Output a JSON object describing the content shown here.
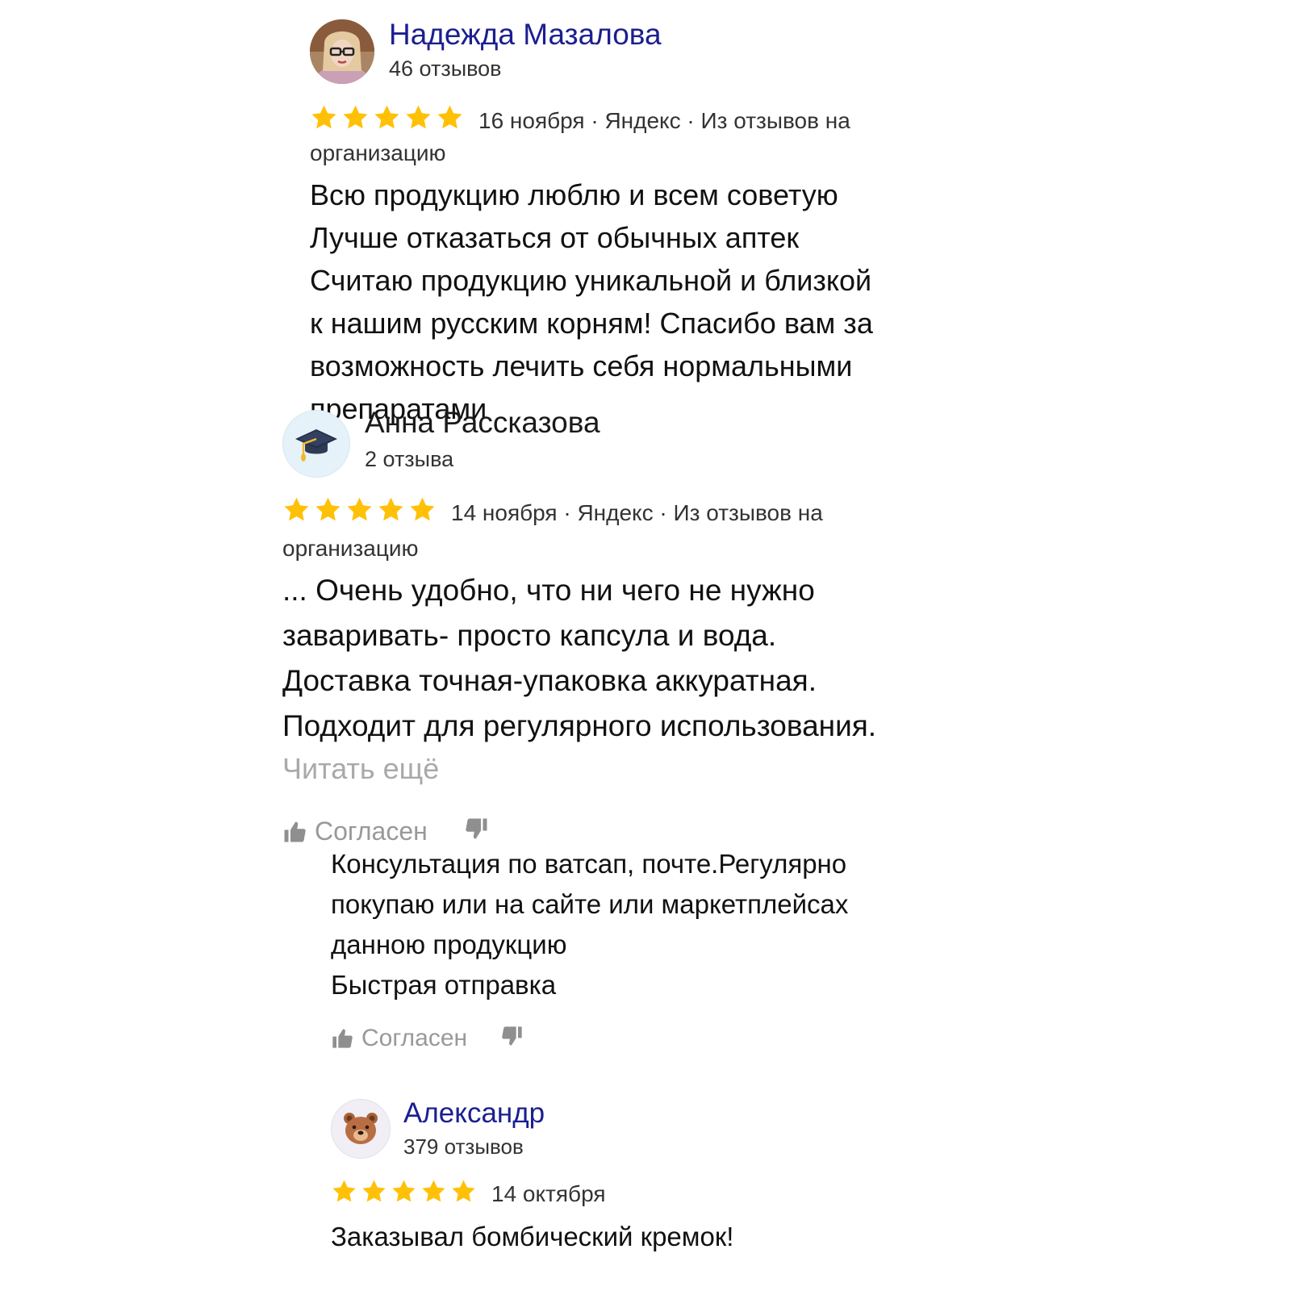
{
  "colors": {
    "author": "#1b1f8f",
    "star": "#ffc107",
    "muted": "#999999"
  },
  "reviews": [
    {
      "author": "Надежда Мазалова",
      "count": "46 отзывов",
      "rating": 5,
      "meta_line1": "16 ноября · Яндекс · Из отзывов на",
      "meta_line2": "организацию",
      "lines": [
        "Всю продукцию люблю и всем советую",
        "Лучше отказаться от обычных аптек",
        "Считаю продукцию уникальной и близкой",
        "к нашим русским корням! Спасибо вам за",
        "возможность лечить себя нормальными",
        "препаратами"
      ]
    },
    {
      "author": "Анна Рассказова",
      "count": "2 отзыва",
      "avatar_icon": "graduation-cap-icon",
      "rating": 5,
      "meta_line1": "14 ноября · Яндекс · Из отзывов на",
      "meta_line2": "организацию",
      "lines": [
        "... Очень удобно, что ни чего не нужно",
        "заваривать- просто капсула и вода.",
        "Доставка точная-упаковка аккуратная.",
        "Подходит для регулярного использования."
      ],
      "read_more": "Читать ещё",
      "agree": "Согласен"
    },
    {
      "lines": [
        "Консультация по ватсап, почте.Регулярно",
        "покупаю или на сайте или маркетплейсах",
        "данною продукцию",
        "Быстрая отправка"
      ],
      "agree": "Согласен"
    },
    {
      "author": "Александр",
      "count": "379 отзывов",
      "avatar_icon": "bear-face-icon",
      "rating": 5,
      "date": "14 октября",
      "lines": [
        "Заказывал бомбический кремок!"
      ]
    }
  ]
}
